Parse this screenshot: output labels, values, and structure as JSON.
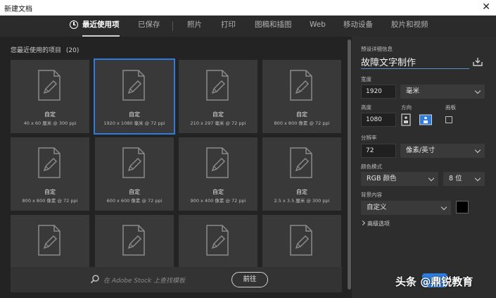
{
  "window": {
    "title": "新建文档",
    "close": "✕"
  },
  "tabs": [
    {
      "label": "最近使用项",
      "active": true
    },
    {
      "label": "已保存"
    },
    {
      "label": "照片"
    },
    {
      "label": "打印"
    },
    {
      "label": "图稿和插图"
    },
    {
      "label": "Web"
    },
    {
      "label": "移动设备"
    },
    {
      "label": "胶片和视频"
    }
  ],
  "recent": {
    "title": "您最近使用的项目",
    "count": "(20)",
    "items": [
      {
        "label": "自定",
        "size": "40 x 60 厘米 @ 300 ppi"
      },
      {
        "label": "自定",
        "size": "1920 x 1080 毫米 @ 72 ppi",
        "selected": true
      },
      {
        "label": "自定",
        "size": "210 x 297 毫米 @ 72 ppi"
      },
      {
        "label": "自定",
        "size": "800 x 800 像素 @ 72 ppi"
      },
      {
        "label": "自定",
        "size": "800 x 800 像素 @ 72 ppi"
      },
      {
        "label": "自定",
        "size": "600 x 600 像素 @ 72 ppi"
      },
      {
        "label": "自定",
        "size": "900 x 400 像素 @ 72 ppi"
      },
      {
        "label": "自定",
        "size": "2.5 x 3.5 厘米 @ 300 ppi"
      },
      {
        "label": "",
        "size": ""
      },
      {
        "label": "",
        "size": ""
      },
      {
        "label": "",
        "size": ""
      },
      {
        "label": "",
        "size": ""
      }
    ]
  },
  "stock": {
    "placeholder": "在 Adobe Stock 上查找模板",
    "go_label": "前往"
  },
  "preset": {
    "header": "预设详细信息",
    "name": "故障文字制作",
    "width_label": "宽度",
    "width_value": "1920",
    "width_unit": "毫米",
    "height_label": "高度",
    "height_value": "1080",
    "orientation_label": "方向",
    "artboard_label": "画板",
    "resolution_label": "分辨率",
    "resolution_value": "72",
    "resolution_unit": "像素/英寸",
    "color_mode_label": "颜色模式",
    "color_mode_value": "RGB 颜色",
    "bit_depth": "8 位",
    "background_label": "背景内容",
    "background_value": "自定义",
    "background_color": "#000000",
    "advanced_label": "高级选项"
  },
  "watermark": {
    "text": "头条 @鼎锐教育"
  },
  "colors": {
    "accent": "#2d7de0"
  }
}
